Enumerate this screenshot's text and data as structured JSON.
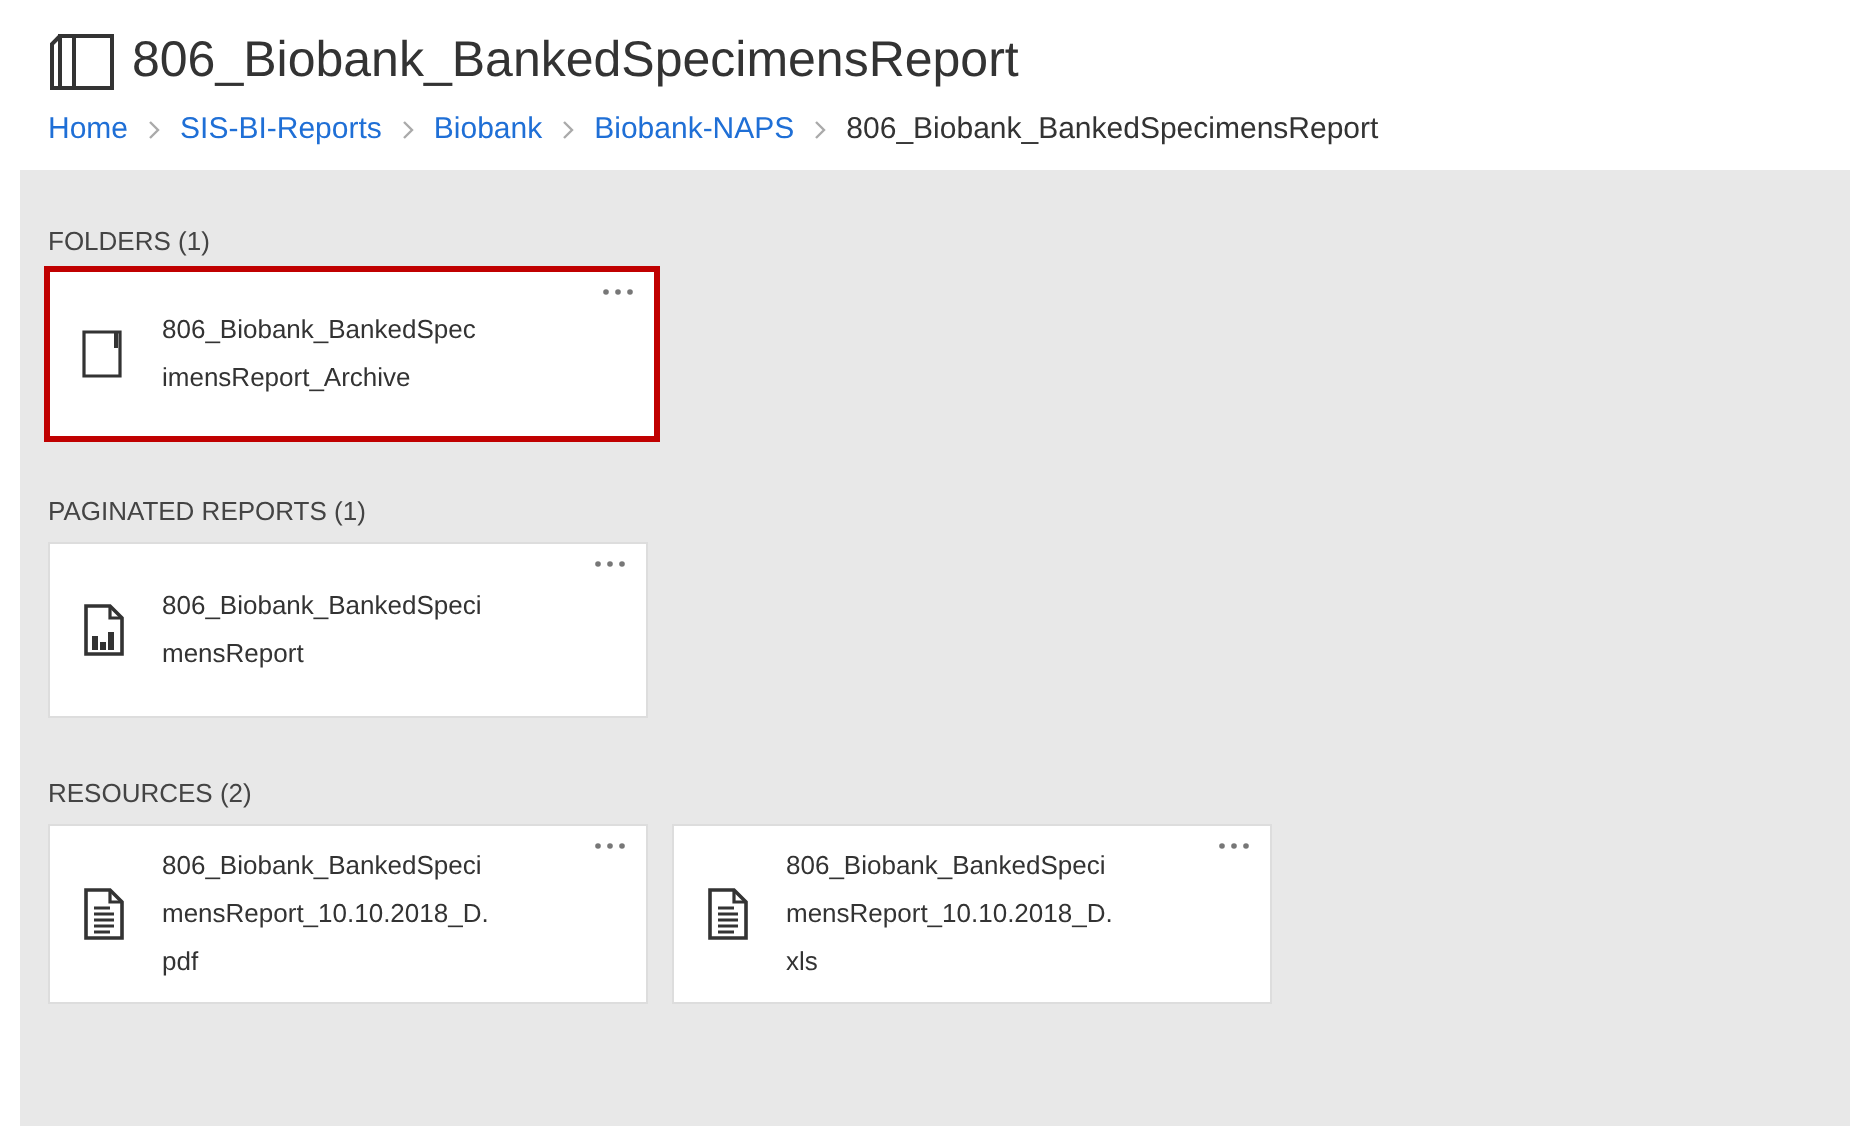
{
  "title": "806_Biobank_BankedSpecimensReport",
  "breadcrumb": [
    {
      "label": "Home",
      "kind": "link"
    },
    {
      "label": "SIS-BI-Reports",
      "kind": "link"
    },
    {
      "label": "Biobank",
      "kind": "link"
    },
    {
      "label": "Biobank-NAPS",
      "kind": "link"
    },
    {
      "label": "806_Biobank_BankedSpecimensReport",
      "kind": "current"
    }
  ],
  "sections": [
    {
      "heading": "FOLDERS (1)",
      "items": [
        {
          "kind": "folder",
          "name_lines": [
            "806_Biobank_BankedSpec",
            "imensReport_Archive"
          ],
          "highlighted": true
        }
      ]
    },
    {
      "heading": "PAGINATED REPORTS (1)",
      "items": [
        {
          "kind": "report",
          "name_lines": [
            "806_Biobank_BankedSpeci",
            "mensReport"
          ],
          "highlighted": false
        }
      ]
    },
    {
      "heading": "RESOURCES (2)",
      "items": [
        {
          "kind": "file",
          "name_lines": [
            "806_Biobank_BankedSpeci",
            "mensReport_10.10.2018_D.",
            "pdf"
          ],
          "highlighted": false
        },
        {
          "kind": "file",
          "name_lines": [
            "806_Biobank_BankedSpeci",
            "mensReport_10.10.2018_D.",
            "xls"
          ],
          "highlighted": false
        }
      ]
    }
  ]
}
